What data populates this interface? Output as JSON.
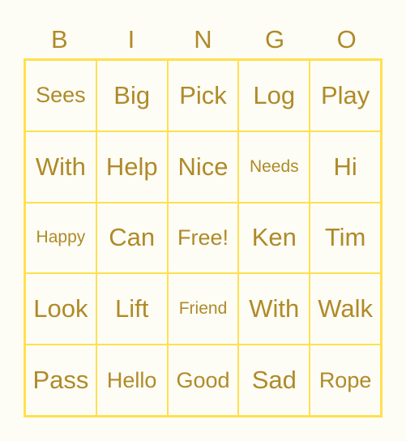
{
  "colors": {
    "background": "#FDFDF6",
    "border": "#FFE04D",
    "text": "#B08A28"
  },
  "header": [
    "B",
    "I",
    "N",
    "G",
    "O"
  ],
  "rows": [
    [
      "Sees",
      "Big",
      "Pick",
      "Log",
      "Play"
    ],
    [
      "With",
      "Help",
      "Nice",
      "Needs",
      "Hi"
    ],
    [
      "Happy",
      "Can",
      "Free!",
      "Ken",
      "Tim"
    ],
    [
      "Look",
      "Lift",
      "Friend",
      "With",
      "Walk"
    ],
    [
      "Pass",
      "Hello",
      "Good",
      "Sad",
      "Rope"
    ]
  ]
}
